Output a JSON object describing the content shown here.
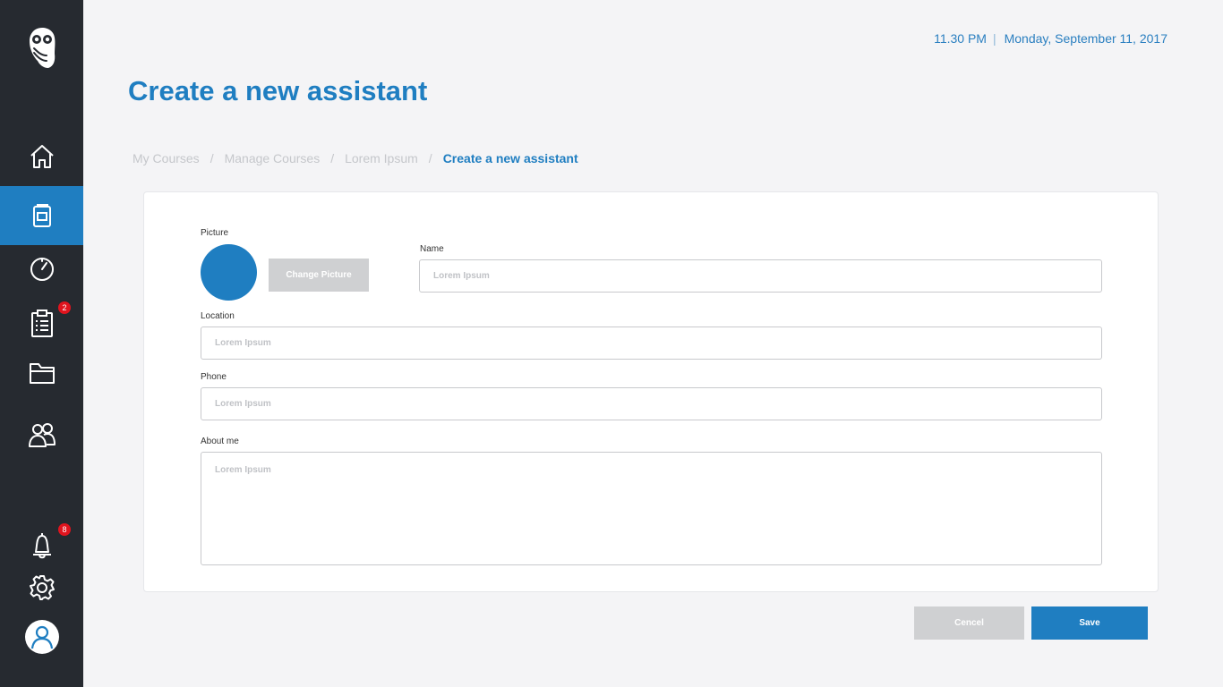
{
  "header": {
    "time": "11.30 PM",
    "separator": "|",
    "date": "Monday, September 11, 2017"
  },
  "page": {
    "title": "Create a new assistant"
  },
  "breadcrumb": {
    "items": [
      "My Courses",
      "Manage Courses",
      "Lorem Ipsum",
      "Create a new assistant"
    ],
    "separator": "/"
  },
  "sidebar": {
    "items": [
      {
        "name": "owl-logo-icon"
      },
      {
        "name": "home-icon"
      },
      {
        "name": "courses-icon",
        "active": true
      },
      {
        "name": "clock-icon"
      },
      {
        "name": "clipboard-icon",
        "badge": "2"
      },
      {
        "name": "folder-icon"
      },
      {
        "name": "users-icon"
      },
      {
        "name": "bell-icon",
        "badge": "8"
      },
      {
        "name": "gear-icon"
      },
      {
        "name": "user-avatar-icon"
      }
    ],
    "accent": "#1f7ec1",
    "background": "#262a30"
  },
  "form": {
    "picture_label": "Picture",
    "change_picture": "Change Picture",
    "name_label": "Name",
    "name_placeholder": "Lorem Ipsum",
    "location_label": "Location",
    "location_placeholder": "Lorem Ipsum",
    "phone_label": "Phone",
    "phone_placeholder": "Lorem Ipsum",
    "about_label": "About me",
    "about_placeholder": "Lorem Ipsum"
  },
  "actions": {
    "cancel": "Cencel",
    "save": "Save"
  }
}
